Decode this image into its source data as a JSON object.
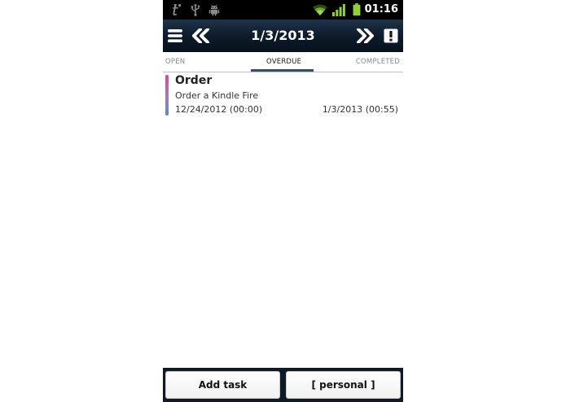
{
  "status_bar": {
    "time": "01:16",
    "icons": [
      "tasks-app-icon",
      "usb-icon",
      "android-debug-icon",
      "wifi-icon",
      "signal-icon",
      "battery-icon"
    ]
  },
  "action_bar": {
    "title": "1/3/2013",
    "icons": [
      "menu-icon",
      "prev-day-icon",
      "next-day-icon",
      "priority-icon"
    ]
  },
  "tabs": [
    {
      "label": "OPEN",
      "active": false
    },
    {
      "label": "OVERDUE",
      "active": true
    },
    {
      "label": "COMPLETED",
      "active": false
    }
  ],
  "tasks": [
    {
      "title": "Order",
      "description": "Order a Kindle Fire",
      "start": "12/24/2012 (00:00)",
      "end": "1/3/2013 (00:55)"
    }
  ],
  "bottom_bar": {
    "add_task_label": "Add task",
    "list_label": "[ personal ]"
  },
  "colors": {
    "action_bar": "#0c1a2a",
    "tab_indicator": "#34506c",
    "task_gradient_top": "#e2478c",
    "task_gradient_bottom": "#5b8ad0"
  }
}
